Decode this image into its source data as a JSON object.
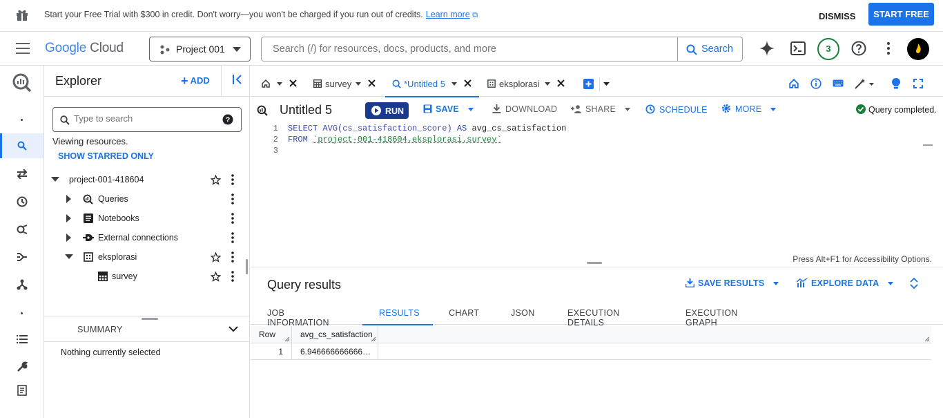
{
  "banner": {
    "text": "Start your Free Trial with $300 in credit. Don't worry—you won't be charged if you run out of credits.",
    "link": "Learn more",
    "dismiss": "DISMISS",
    "start_free": "START FREE"
  },
  "header": {
    "logo_google": "Google",
    "logo_cloud": "Cloud",
    "project": "Project 001",
    "search_placeholder": "Search (/) for resources, docs, products, and more",
    "search_button": "Search",
    "notifications_count": "3"
  },
  "explorer": {
    "title": "Explorer",
    "add": "ADD",
    "search_placeholder": "Type to search",
    "viewing": "Viewing resources.",
    "show_starred": "SHOW STARRED ONLY",
    "project": "project-001-418604",
    "items": {
      "queries": "Queries",
      "notebooks": "Notebooks",
      "external": "External connections",
      "dataset": "eksplorasi",
      "table": "survey"
    },
    "summary": "SUMMARY",
    "nothing_selected": "Nothing currently selected"
  },
  "tabs": {
    "survey": "survey",
    "untitled": "*Untitled 5",
    "eksplorasi": "eksplorasi"
  },
  "editor": {
    "title": "Untitled 5",
    "run": "RUN",
    "save": "SAVE",
    "download": "DOWNLOAD",
    "share": "SHARE",
    "schedule": "SCHEDULE",
    "more": "MORE",
    "status": "Query completed.",
    "line_numbers": [
      "1",
      "2",
      "3"
    ],
    "line1_kw1": "SELECT",
    "line1_fn": "AVG(cs_satisfaction_score)",
    "line1_kw2": "AS",
    "line1_alias": "avg_cs_satisfaction",
    "line2_kw": "FROM",
    "line2_table": "`project-001-418604.eksplorasi.survey`",
    "accessibility": "Press Alt+F1 for Accessibility Options."
  },
  "results": {
    "title": "Query results",
    "save_results": "SAVE RESULTS",
    "explore_data": "EXPLORE DATA",
    "tabs": {
      "job": "JOB INFORMATION",
      "results": "RESULTS",
      "chart": "CHART",
      "json": "JSON",
      "exec_details": "EXECUTION DETAILS",
      "exec_graph": "EXECUTION GRAPH"
    },
    "columns": {
      "row": "Row",
      "col1": "avg_cs_satisfaction"
    },
    "rows": [
      {
        "row": "1",
        "value": "6.946666666666…"
      }
    ]
  },
  "colors": {
    "primary": "#1a73e8",
    "run_button": "#1a3a8f",
    "success": "#188038"
  }
}
